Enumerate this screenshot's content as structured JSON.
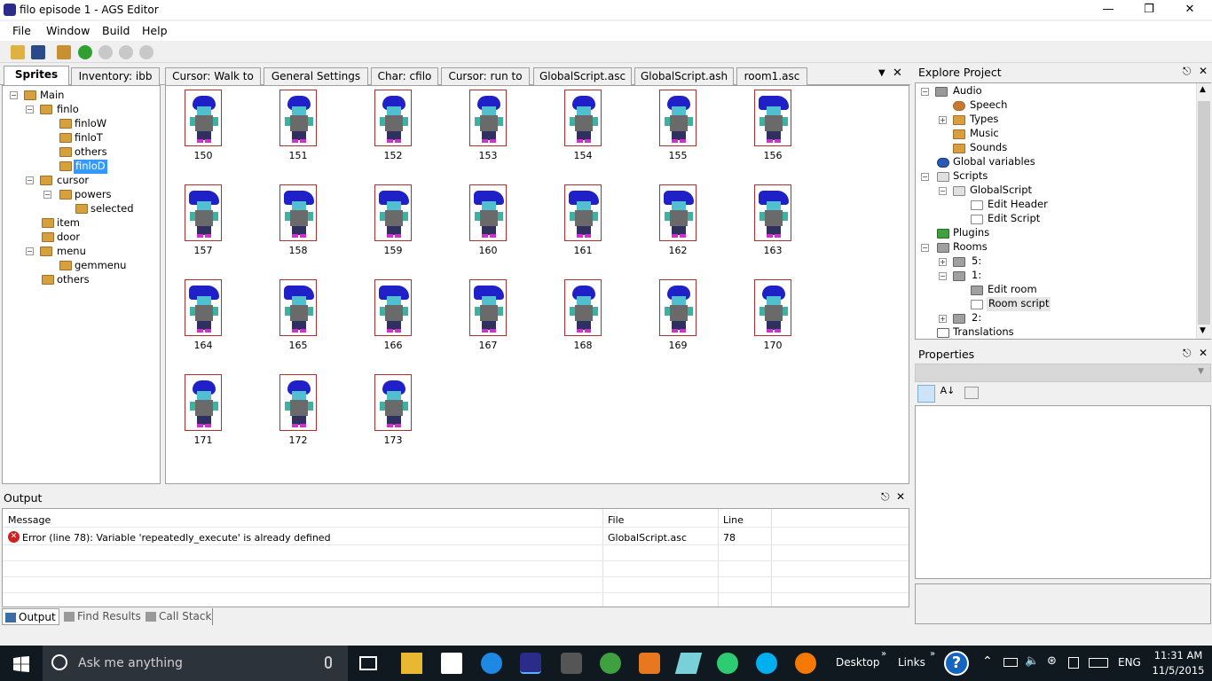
{
  "window": {
    "title": "filo episode 1 - AGS Editor"
  },
  "menu": [
    "File",
    "Window",
    "Build",
    "Help"
  ],
  "tabs": [
    {
      "label": "Sprites"
    },
    {
      "label": "Inventory: ibb"
    },
    {
      "label": "Cursor: Walk to"
    },
    {
      "label": "General Settings"
    },
    {
      "label": "Char: cfilo"
    },
    {
      "label": "Cursor: run to"
    },
    {
      "label": "GlobalScript.asc"
    },
    {
      "label": "GlobalScript.ash"
    },
    {
      "label": "room1.asc"
    }
  ],
  "sprite_tree": [
    "Main",
    "finlo",
    "finloW",
    "finloT",
    "others",
    "finloD",
    "cursor",
    "powers",
    "selected",
    "item",
    "door",
    "menu",
    "gemmenu",
    "others"
  ],
  "sprites": [
    "150",
    "151",
    "152",
    "153",
    "154",
    "155",
    "156",
    "157",
    "158",
    "159",
    "160",
    "161",
    "162",
    "163",
    "164",
    "165",
    "166",
    "167",
    "168",
    "169",
    "170",
    "171",
    "172",
    "173"
  ],
  "explore": {
    "title": "Explore Project",
    "items": [
      "Audio",
      "Speech",
      "Types",
      "Music",
      "Sounds",
      "Global variables",
      "Scripts",
      "GlobalScript",
      "Edit Header",
      "Edit Script",
      "Plugins",
      "Rooms",
      "5:",
      "1:",
      "Edit room",
      "Room script",
      "2:",
      "Translations"
    ]
  },
  "properties": {
    "title": "Properties"
  },
  "output": {
    "title": "Output",
    "headers": {
      "message": "Message",
      "file": "File",
      "line": "Line"
    },
    "row": {
      "message": "Error (line 78): Variable 'repeatedly_execute' is already defined",
      "file": "GlobalScript.asc",
      "line": "78"
    },
    "bottom_tabs": [
      "Output",
      "Find Results",
      "Call Stack"
    ]
  },
  "taskbar": {
    "search_placeholder": "Ask me anything",
    "desktop": "Desktop",
    "links": "Links",
    "lang": "ENG",
    "time": "11:31 AM",
    "date": "11/5/2015"
  },
  "colors": {
    "selection": "#3399ff",
    "error": "#d02020",
    "taskbar": "#101820"
  }
}
